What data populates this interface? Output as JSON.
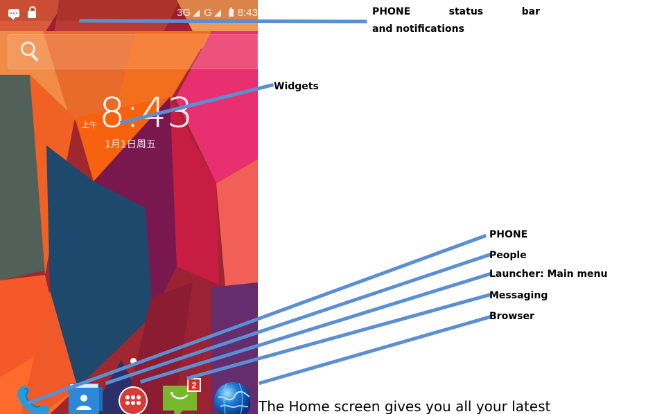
{
  "phone": {
    "status_bar": {
      "network": "3G",
      "network_second": "G",
      "time": "8:43",
      "left_icons": [
        "chat-icon",
        "lock-icon"
      ],
      "right_icons": [
        "signal-icon",
        "signal-icon",
        "battery-icon"
      ]
    },
    "search": {
      "icon": "search-icon"
    },
    "clock": {
      "ampm": "上午",
      "time": "8:43",
      "date": "1月1日周五"
    },
    "dock": {
      "items": [
        {
          "name": "phone",
          "icon": "phone-icon"
        },
        {
          "name": "people",
          "icon": "people-icon"
        },
        {
          "name": "launcher",
          "icon": "launcher-icon"
        },
        {
          "name": "messaging",
          "icon": "messaging-icon",
          "badge": "2"
        },
        {
          "name": "browser",
          "icon": "browser-icon"
        }
      ]
    }
  },
  "callouts": {
    "status_line1": "PHONE status bar",
    "status_line2": "and notifications",
    "widgets": "Widgets",
    "phone": "PHONE",
    "people": "People",
    "launcher": "Launcher: Main menu",
    "messaging": "Messaging",
    "browser": "Browser"
  },
  "page_text": "The Home screen gives you all your latest",
  "colors": {
    "annotation_line": "#5b8fd4",
    "phone_blue": "#279ad9",
    "people_blue": "#2d88d8",
    "launcher_red": "#d93a36",
    "messaging_green": "#78b82c",
    "badge_red": "#e12a25"
  }
}
